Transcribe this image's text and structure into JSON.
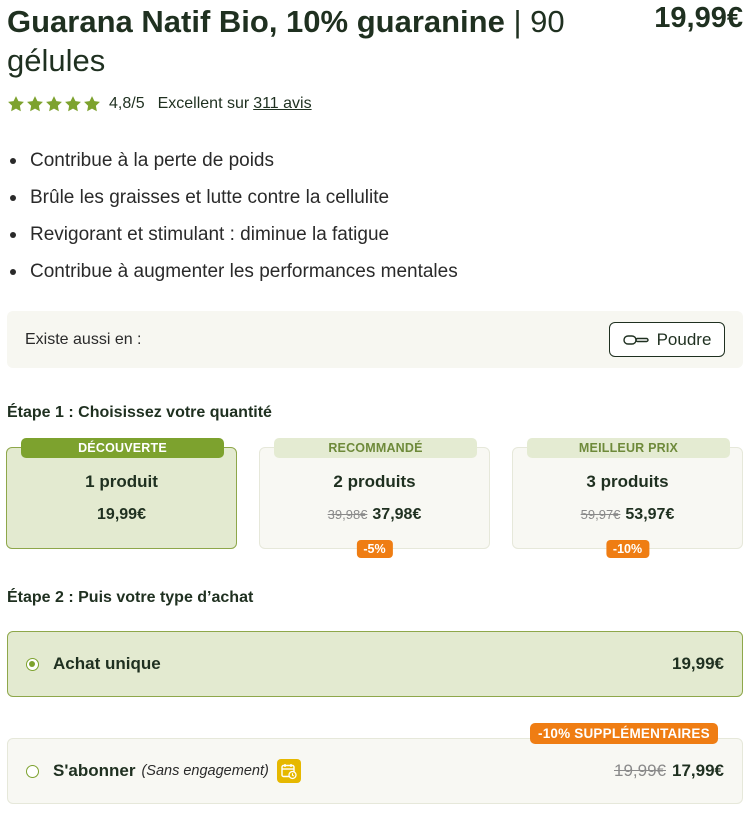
{
  "product": {
    "title_bold": "Guarana Natif Bio, 10% guaranine",
    "separator": "|",
    "title_light": "90 gélules",
    "price": "19,99€"
  },
  "rating": {
    "stars": 5,
    "star_color": "#7da22e",
    "score": "4,8/5",
    "label": "Excellent sur",
    "reviews": "311 avis"
  },
  "benefits": [
    "Contribue à la perte de poids",
    "Brûle les graisses et lutte contre la cellulite",
    "Revigorant et stimulant : diminue la fatigue",
    "Contribue à augmenter les performances mentales"
  ],
  "variant": {
    "label": "Existe aussi en :",
    "option_label": "Poudre",
    "option_icon": "scoop-icon"
  },
  "step1": {
    "title": "Étape 1 : Choisissez votre quantité",
    "cards": [
      {
        "tag": "DÉCOUVERTE",
        "qty": "1 produit",
        "old_price": "",
        "price": "19,99€",
        "discount": "",
        "selected": true
      },
      {
        "tag": "RECOMMANDÉ",
        "qty": "2 produits",
        "old_price": "39,98€",
        "price": "37,98€",
        "discount": "-5%",
        "selected": false
      },
      {
        "tag": "MEILLEUR PRIX",
        "qty": "3 produits",
        "old_price": "59,97€",
        "price": "53,97€",
        "discount": "-10%",
        "selected": false
      }
    ]
  },
  "step2": {
    "title": "Étape 2 : Puis votre type d’achat",
    "one_time": {
      "label": "Achat unique",
      "price": "19,99€",
      "selected": true
    },
    "subscription": {
      "badge": "-10% SUPPLÉMENTAIRES",
      "label": "S'abonner",
      "note": "(Sans engagement)",
      "icon": "calendar-clock-icon",
      "old_price": "19,99€",
      "price": "17,99€",
      "selected": false
    }
  },
  "colors": {
    "accent_green": "#7da22e",
    "selected_bg": "#e3ead0",
    "discount_orange": "#ef7d13",
    "calendar_yellow": "#e6b800"
  }
}
